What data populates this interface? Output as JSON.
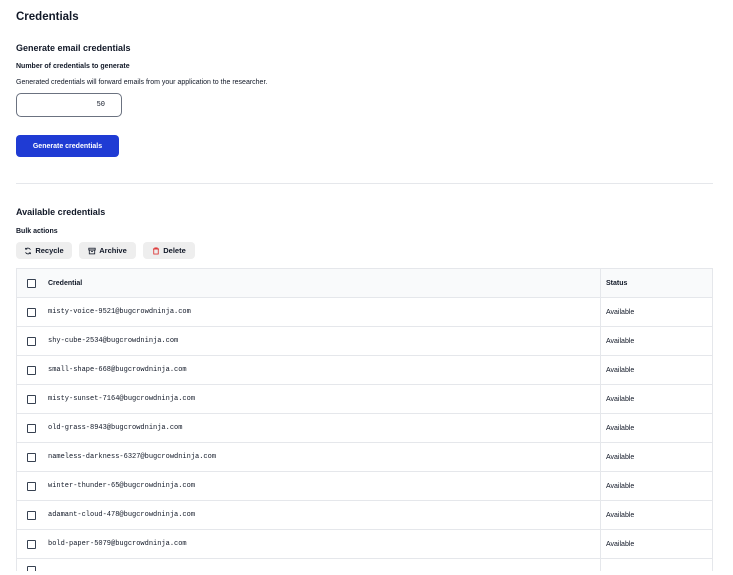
{
  "page": {
    "title": "Credentials"
  },
  "generate": {
    "title": "Generate email credentials",
    "count_label": "Number of credentials to generate",
    "helper": "Generated credentials will forward emails from your application to the researcher.",
    "count_value": "50",
    "button_label": "Generate credentials",
    "button_color": "#1f3bd4"
  },
  "available": {
    "title": "Available credentials",
    "bulk_label": "Bulk actions",
    "actions": {
      "recycle": {
        "label": "Recycle",
        "icon": "recycle-icon"
      },
      "archive": {
        "label": "Archive",
        "icon": "archive-icon"
      },
      "delete": {
        "label": "Delete",
        "icon": "trash-icon",
        "icon_color": "#dc2626"
      }
    }
  },
  "table": {
    "headers": {
      "credential": "Credential",
      "status": "Status"
    },
    "rows": [
      {
        "credential": "misty-voice-9521@bugcrowdninja.com",
        "status": "Available"
      },
      {
        "credential": "shy-cube-2534@bugcrowdninja.com",
        "status": "Available"
      },
      {
        "credential": "small-shape-668@bugcrowdninja.com",
        "status": "Available"
      },
      {
        "credential": "misty-sunset-7164@bugcrowdninja.com",
        "status": "Available"
      },
      {
        "credential": "old-grass-8943@bugcrowdninja.com",
        "status": "Available"
      },
      {
        "credential": "nameless-darkness-6327@bugcrowdninja.com",
        "status": "Available"
      },
      {
        "credential": "winter-thunder-65@bugcrowdninja.com",
        "status": "Available"
      },
      {
        "credential": "adamant-cloud-478@bugcrowdninja.com",
        "status": "Available"
      },
      {
        "credential": "bold-paper-5079@bugcrowdninja.com",
        "status": "Available"
      }
    ]
  }
}
